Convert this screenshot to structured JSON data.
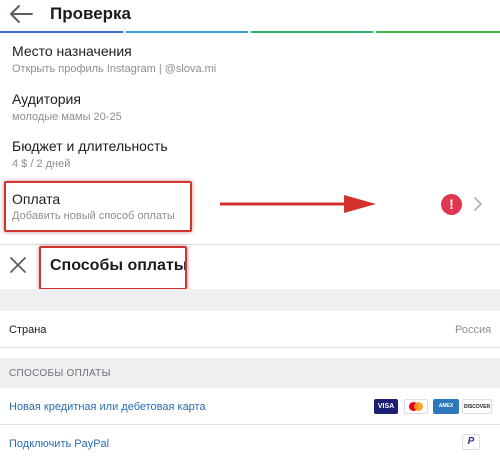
{
  "header": {
    "title": "Проверка",
    "back_icon": "arrow-left-icon"
  },
  "progress": {
    "segments": 4,
    "completed": 4,
    "colors": [
      "#3a6cc6",
      "#35a3d6",
      "#2ab673",
      "#43b549"
    ]
  },
  "rows": [
    {
      "title": "Место назначения",
      "subtitle": "Открыть профиль Instagram | @slova.mi"
    },
    {
      "title": "Аудитория",
      "subtitle": "молодые мамы 20-25"
    },
    {
      "title": "Бюджет и длительность",
      "subtitle": "4 $ / 2 дней"
    },
    {
      "title": "Оплата",
      "subtitle": "Добавить новый способ оплаты",
      "status_icon": "error-icon",
      "status_color": "#e0364f"
    }
  ],
  "highlight_color": "#d0342c",
  "payment_panel": {
    "title": "Способы оплаты",
    "close_icon": "close-icon",
    "country_label": "Страна",
    "country_value": "Россия",
    "section_label": "СПОСОБЫ ОПЛАТЫ",
    "methods": [
      {
        "label": "Новая кредитная или дебетовая карта",
        "logos": [
          "VISA",
          "MasterCard",
          "AMEX",
          "DISCOVER"
        ]
      },
      {
        "label": "Подключить PayPal",
        "logos": [
          "P"
        ]
      }
    ],
    "link_color": "#2a6db5"
  }
}
